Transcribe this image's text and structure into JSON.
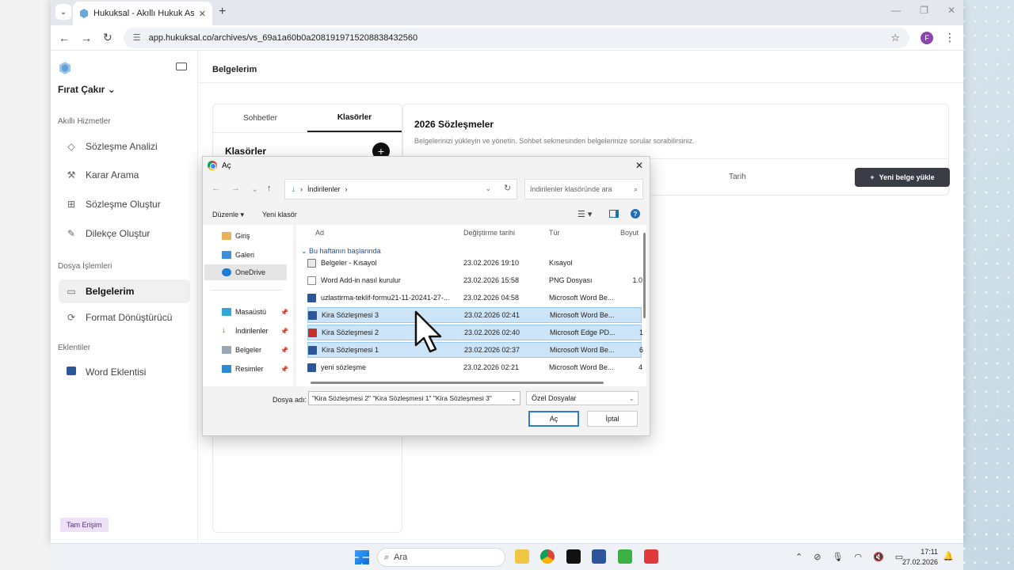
{
  "browser": {
    "tab_title": "Hukuksal - Akıllı Hukuk Asistanı",
    "url": "app.hukuksal.co/archives/vs_69a1a60b0a2081919715208838432560",
    "avatar_letter": "F"
  },
  "sidebar": {
    "user_name": "Fırat Çakır",
    "sections": {
      "smart": "Akıllı Hizmetler",
      "files": "Dosya İşlemleri",
      "plugins": "Eklentiler"
    },
    "items": [
      {
        "label": "Sözleşme Analizi",
        "icon": "gem-icon"
      },
      {
        "label": "Karar Arama",
        "icon": "gavel-icon"
      },
      {
        "label": "Sözleşme Oluştur",
        "icon": "plus-square-icon"
      },
      {
        "label": "Dilekçe Oluştur",
        "icon": "edit-icon"
      },
      {
        "label": "Belgelerim",
        "icon": "folder-icon"
      },
      {
        "label": "Format Dönüştürücü",
        "icon": "convert-icon"
      },
      {
        "label": "Word Eklentisi",
        "icon": "word-icon"
      }
    ],
    "full_access": "Tam Erişim"
  },
  "main": {
    "page_title": "Belgelerim",
    "tabs": [
      "Sohbetler",
      "Klasörler"
    ],
    "folders_heading": "Klasörler",
    "folder_title": "2026 Sözleşmeler",
    "folder_subtitle": "Belgelerinizi yükleyin ve yönetin. Sohbet sekmesinden belgelerinize sorular sorabilirsiniz.",
    "col_date": "Tarih",
    "upload_button": "Yeni belge yükle"
  },
  "dialog": {
    "title": "Aç",
    "path": "İndirilenler",
    "search_placeholder": "İndirilenler klasöründe ara",
    "organize": "Düzenle",
    "new_folder": "Yeni klasör",
    "nav_items": [
      "Giriş",
      "Galeri",
      "OneDrive",
      "Masaüstü",
      "İndirilenler",
      "Belgeler",
      "Resimler"
    ],
    "columns": {
      "name": "Ad",
      "date": "Değiştirme tarihi",
      "type": "Tür",
      "size": "Boyut"
    },
    "group": "Bu haftanın başlarında",
    "files": [
      {
        "name": "Belgeler - Kısayol",
        "date": "23.02.2026 19:10",
        "type": "Kısayol",
        "size": "",
        "icon": "lnk",
        "selected": false
      },
      {
        "name": "Word Add-in nasıl kurulur",
        "date": "23.02.2026 15:58",
        "type": "PNG Dosyası",
        "size": "1.0",
        "icon": "png",
        "selected": false
      },
      {
        "name": "uzlastirma-teklif-formu21-11-20241-27-...",
        "date": "23.02.2026 04:58",
        "type": "Microsoft Word Be...",
        "size": "",
        "icon": "word",
        "selected": false
      },
      {
        "name": "Kira Sözleşmesi 3",
        "date": "23.02.2026 02:41",
        "type": "Microsoft Word Be...",
        "size": "",
        "icon": "word",
        "selected": true
      },
      {
        "name": "Kira Sözleşmesi 2",
        "date": "23.02.2026 02:40",
        "type": "Microsoft Edge PD...",
        "size": "1",
        "icon": "pdf",
        "selected": true
      },
      {
        "name": "Kira Sözleşmesi 1",
        "date": "23.02.2026 02:37",
        "type": "Microsoft Word Be...",
        "size": "6",
        "icon": "word",
        "selected": true
      },
      {
        "name": "yeni sözleşme",
        "date": "23.02.2026 02:21",
        "type": "Microsoft Word Be...",
        "size": "4",
        "icon": "word",
        "selected": false
      }
    ],
    "filename_label": "Dosya adı:",
    "filename_value": "\"Kira Sözleşmesi 2\" \"Kira Sözleşmesi 1\" \"Kira Sözleşmesi 3\"",
    "filetype": "Özel Dosyalar",
    "open_button": "Aç",
    "cancel_button": "İptal"
  },
  "taskbar": {
    "search": "Ara",
    "time": "17:11",
    "date": "27.02.2026"
  }
}
